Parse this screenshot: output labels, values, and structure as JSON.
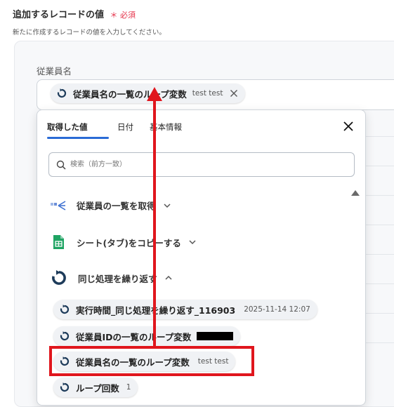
{
  "section": {
    "title": "追加するレコードの値",
    "required_mark": "＊",
    "required_label": "必須",
    "description": "新たに作成するレコードの値を入力してください。"
  },
  "field": {
    "label": "従業員名",
    "selected_chip": {
      "label": "従業員名の一覧のループ変数",
      "value": "test test"
    }
  },
  "dropdown": {
    "tabs": [
      "取得した値",
      "日付",
      "基本情報"
    ],
    "active_tab": "取得した値",
    "search_placeholder": "検索（前方一致）",
    "groups": [
      {
        "label": "従業員の一覧を取得",
        "icon": "app-logo-icon",
        "expanded": false
      },
      {
        "label": "シート(タブ)をコピーする",
        "icon": "google-sheets-icon",
        "expanded": false
      },
      {
        "label": "同じ処理を繰り返す",
        "icon": "loop-icon",
        "expanded": true
      }
    ],
    "items": [
      {
        "label": "実行時間_同じ処理を繰り返す_116903",
        "value": "2025-11-14 12:07"
      },
      {
        "label": "従業員IDの一覧のループ変数",
        "value": ""
      },
      {
        "label": "従業員名の一覧のループ変数",
        "value": "test test"
      },
      {
        "label": "ループ回数",
        "value": "1"
      }
    ]
  },
  "colors": {
    "accent": "#2a6bd6",
    "highlight": "#e0161d",
    "required": "#e5324a"
  }
}
